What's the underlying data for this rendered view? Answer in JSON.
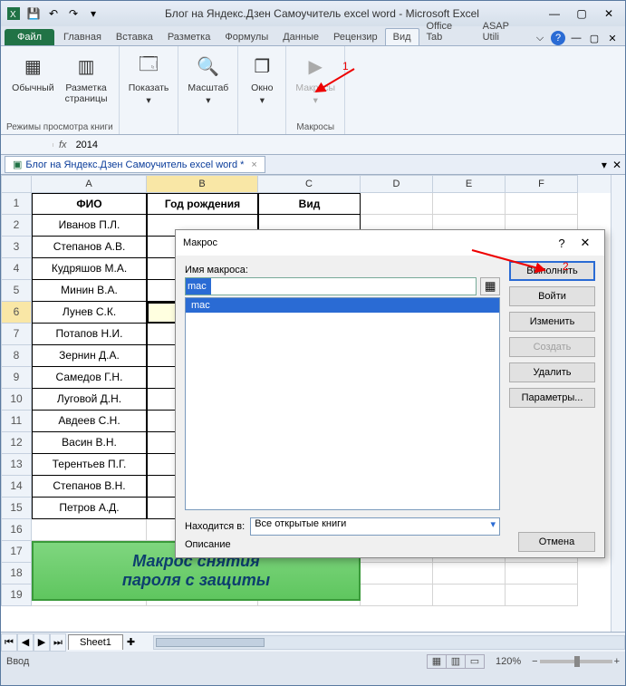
{
  "titlebar": {
    "title": "Блог на Яндекс.Дзен Самоучитель excel word  -  Microsoft Excel"
  },
  "tabs": {
    "file": "Файл",
    "items": [
      "Главная",
      "Вставка",
      "Разметка",
      "Формулы",
      "Данные",
      "Рецензир",
      "Вид",
      "Office Tab",
      "ASAP Utili"
    ]
  },
  "ribbon": {
    "group1": {
      "label": "Режимы просмотра книги",
      "btn1": "Обычный",
      "btn2": "Разметка\nстраницы"
    },
    "group2": {
      "btn": "Показать"
    },
    "group3": {
      "btn": "Масштаб"
    },
    "group4": {
      "btn": "Окно"
    },
    "group5": {
      "label": "Макросы",
      "btn": "Макросы"
    }
  },
  "formula": {
    "fx": "fx",
    "value": "2014"
  },
  "doctab": {
    "name": "Блог на Яндекс.Дзен Самоучитель excel word *"
  },
  "columns": [
    "A",
    "B",
    "C",
    "D",
    "E",
    "F"
  ],
  "headers": {
    "A": "ФИО",
    "B": "Год рождения",
    "C": "Вид"
  },
  "rows": [
    {
      "n": 1,
      "a": "ФИО",
      "b": "Год рождения",
      "c": "Вид",
      "hdr": true
    },
    {
      "n": 2,
      "a": "Иванов П.Л."
    },
    {
      "n": 3,
      "a": "Степанов А.В."
    },
    {
      "n": 4,
      "a": "Кудряшов М.А."
    },
    {
      "n": 5,
      "a": "Минин В.А."
    },
    {
      "n": 6,
      "a": "Лунев С.К.",
      "sel": true
    },
    {
      "n": 7,
      "a": "Потапов Н.И."
    },
    {
      "n": 8,
      "a": "Зернин Д.А."
    },
    {
      "n": 9,
      "a": "Самедов Г.Н."
    },
    {
      "n": 10,
      "a": "Луговой Д.Н."
    },
    {
      "n": 11,
      "a": "Авдеев С.Н."
    },
    {
      "n": 12,
      "a": "Васин В.Н."
    },
    {
      "n": 13,
      "a": "Терентьев П.Г."
    },
    {
      "n": 14,
      "a": "Степанов В.Н."
    },
    {
      "n": 15,
      "a": "Петров А.Д."
    },
    {
      "n": 16
    },
    {
      "n": 17
    },
    {
      "n": 18
    },
    {
      "n": 19
    }
  ],
  "greenbox": {
    "line1": "Макрос снятия",
    "line2": "пароля с защиты"
  },
  "sheet": {
    "name": "Sheet1"
  },
  "status": {
    "mode": "Ввод",
    "zoom": "120%"
  },
  "dialog": {
    "title": "Макрос",
    "name_label": "Имя макроса:",
    "name_value": "mac",
    "list_item": "mac",
    "located_label": "Находится в:",
    "located_value": "Все открытые книги",
    "desc_label": "Описание",
    "btn_run": "Выполнить",
    "btn_step": "Войти",
    "btn_edit": "Изменить",
    "btn_create": "Создать",
    "btn_delete": "Удалить",
    "btn_options": "Параметры...",
    "btn_cancel": "Отмена"
  },
  "annotations": {
    "one": "1",
    "two": "2"
  }
}
